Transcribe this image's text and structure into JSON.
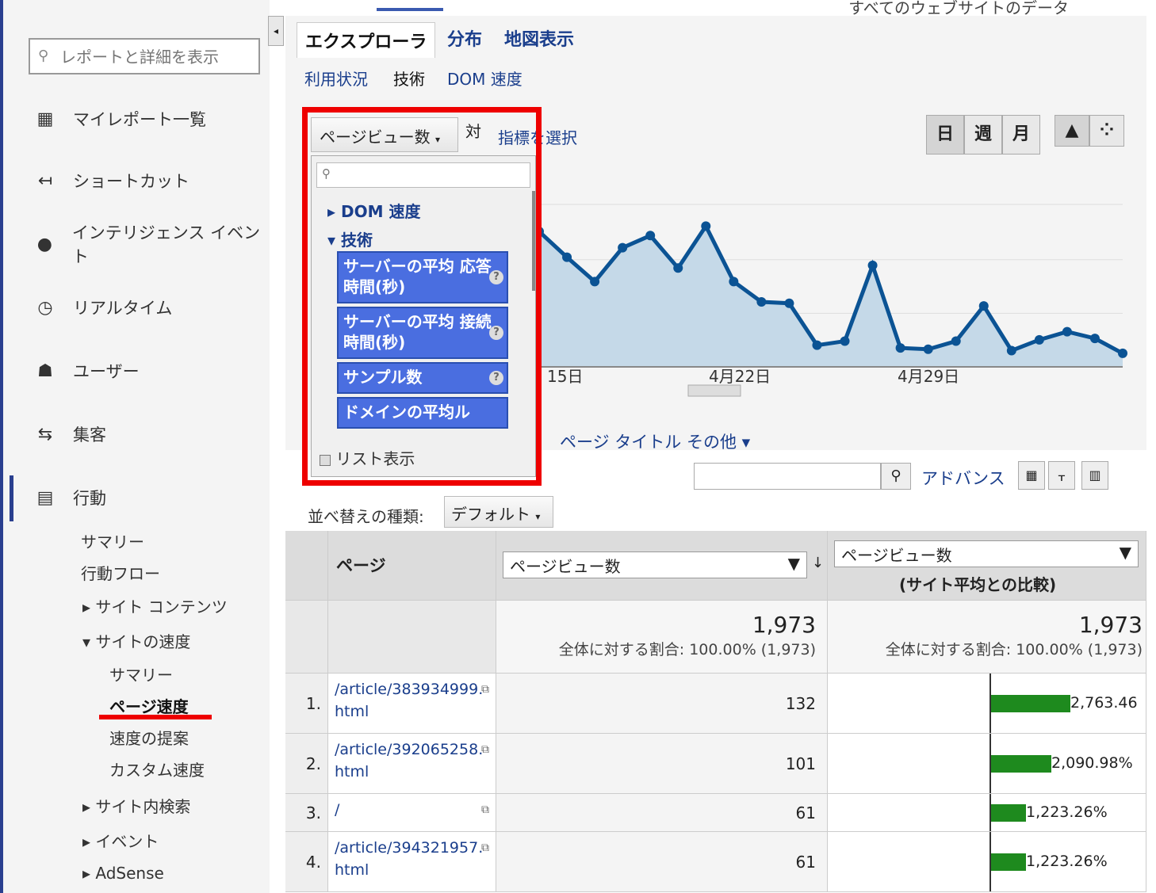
{
  "topbar": {
    "title": "すべてのウェブサイトのデータ"
  },
  "sidebar": {
    "search_placeholder": "レポートと詳細を表示",
    "items": [
      {
        "label": "マイレポート一覧",
        "icon": "grid-icon"
      },
      {
        "label": "ショートカット",
        "icon": "arrow-left-icon"
      },
      {
        "label": "インテリジェンス イベント",
        "icon": "lightbulb-icon"
      },
      {
        "label": "リアルタイム",
        "icon": "clock-icon"
      },
      {
        "label": "ユーザー",
        "icon": "users-icon"
      },
      {
        "label": "集客",
        "icon": "acquisition-icon"
      },
      {
        "label": "行動",
        "icon": "behavior-icon"
      }
    ],
    "behavior_sub": [
      "サマリー",
      "行動フロー",
      "サイト コンテンツ",
      "サイトの速度"
    ],
    "speed_sub": [
      "サマリー",
      "ページ速度",
      "速度の提案",
      "カスタム速度"
    ],
    "more_sub": [
      "サイト内検索",
      "イベント",
      "AdSense"
    ]
  },
  "tabs": {
    "items": [
      "エクスプローラ",
      "分布",
      "地図表示"
    ],
    "subtabs": [
      "利用状況",
      "技術",
      "DOM 速度"
    ]
  },
  "chart_controls": {
    "metric": "ページビュー数",
    "vs": "対",
    "pick_metric": "指標を選択",
    "periods": [
      "日",
      "週",
      "月"
    ]
  },
  "dropdown": {
    "groups": [
      "DOM 速度",
      "技術"
    ],
    "items": [
      "サーバーの平均 応答時間(秒)",
      "サーバーの平均 接続時間(秒)",
      "サンプル数",
      "ドメインの平均ル"
    ],
    "list_view": "リスト表示"
  },
  "chart_data": {
    "type": "area",
    "x_tick_labels": [
      "15日",
      "4月22日",
      "4月29日"
    ],
    "values": [
      1.0,
      0.81,
      0.63,
      0.88,
      0.97,
      0.73,
      1.04,
      0.63,
      0.48,
      0.47,
      0.16,
      0.19,
      0.75,
      0.14,
      0.13,
      0.19,
      0.45,
      0.12,
      0.2,
      0.26,
      0.21,
      0.1
    ],
    "ylim": [
      0,
      1.2
    ],
    "grid": true
  },
  "dimensions": {
    "label_suffix": "ページ タイトル",
    "other": "その他"
  },
  "filter": {
    "advanced": "アドバンス",
    "sort_label": "並べ替えの種類:",
    "sort_value": "デフォルト"
  },
  "table": {
    "col_page": "ページ",
    "col_metric": "ページビュー数",
    "col_compare_select": "ページビュー数",
    "col_compare_sub": "(サイト平均との比較)",
    "total_value": "1,973",
    "total_note": "全体に対する割合: 100.00% (1,973)",
    "rows": [
      {
        "n": "1.",
        "page": "/article/383934999.html",
        "pv": "132",
        "cmp": "2,763.46",
        "frac": 1.0
      },
      {
        "n": "2.",
        "page": "/article/392065258.html",
        "pv": "101",
        "cmp": "2,090.98%",
        "frac": 0.76
      },
      {
        "n": "3.",
        "page": "/",
        "pv": "61",
        "cmp": "1,223.26%",
        "frac": 0.44
      },
      {
        "n": "4.",
        "page": "/article/394321957.html",
        "pv": "61",
        "cmp": "1,223.26%",
        "frac": 0.44
      }
    ]
  }
}
